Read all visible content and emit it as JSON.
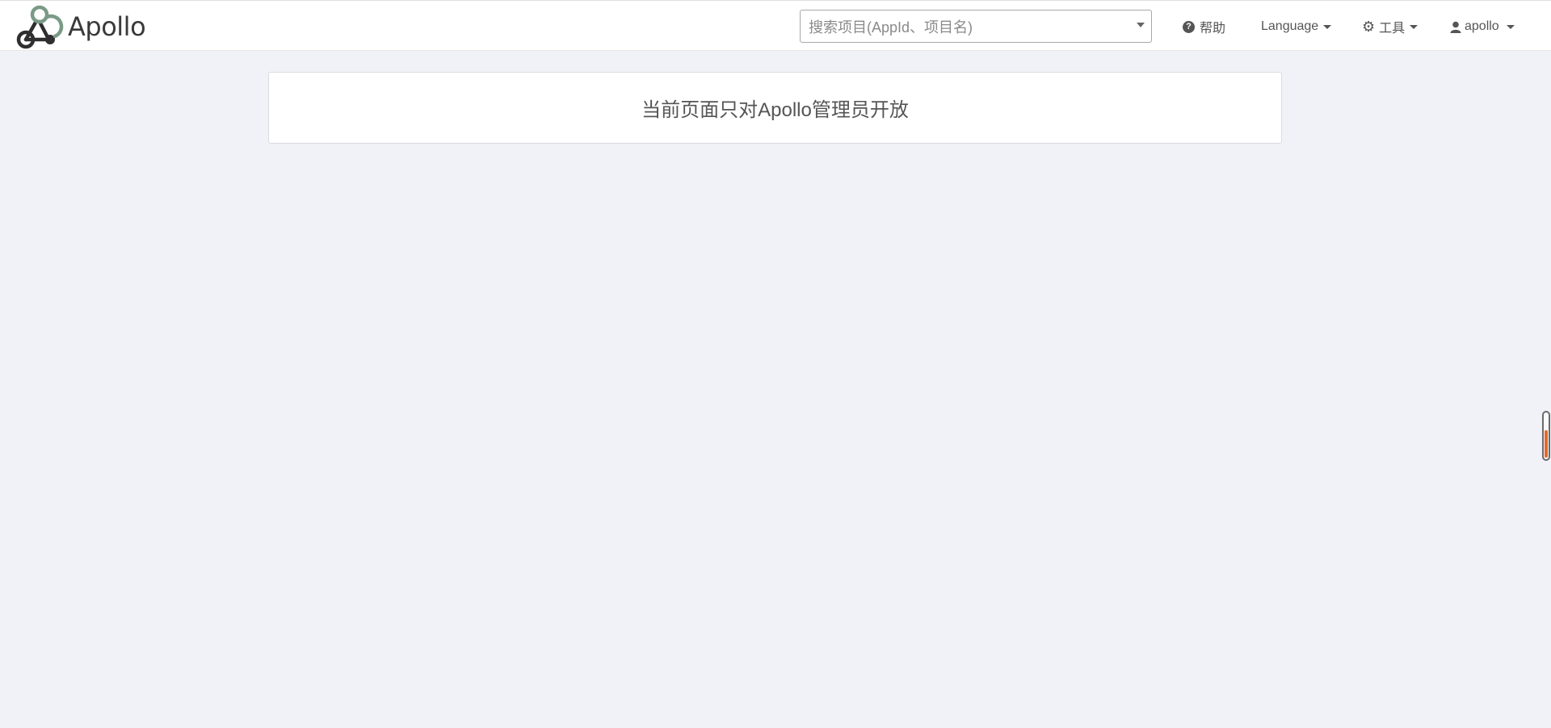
{
  "brand": {
    "name": "Apollo",
    "logo_icon": "apollo-logo-icon",
    "colors": {
      "logo_green": "#7a9a86",
      "logo_dark": "#2f2f2f"
    }
  },
  "search": {
    "placeholder": "搜索项目(AppId、项目名)",
    "icon": "chevron-down-icon"
  },
  "nav": {
    "help": {
      "label": "帮助",
      "icon": "question-circle-icon"
    },
    "language": {
      "label": "Language",
      "icon": "caret-down-icon"
    },
    "tools": {
      "label": "工具",
      "icon": "gear-icon"
    },
    "user": {
      "label": "apollo",
      "icon": "user-icon"
    }
  },
  "main": {
    "message": "当前页面只对Apollo管理员开放"
  },
  "widget": {
    "icon": "scroll-indicator-icon",
    "accent_color": "#e5672c"
  },
  "colors": {
    "page_background": "#f0f2f7",
    "panel_background": "#ffffff",
    "text": "#555555"
  }
}
